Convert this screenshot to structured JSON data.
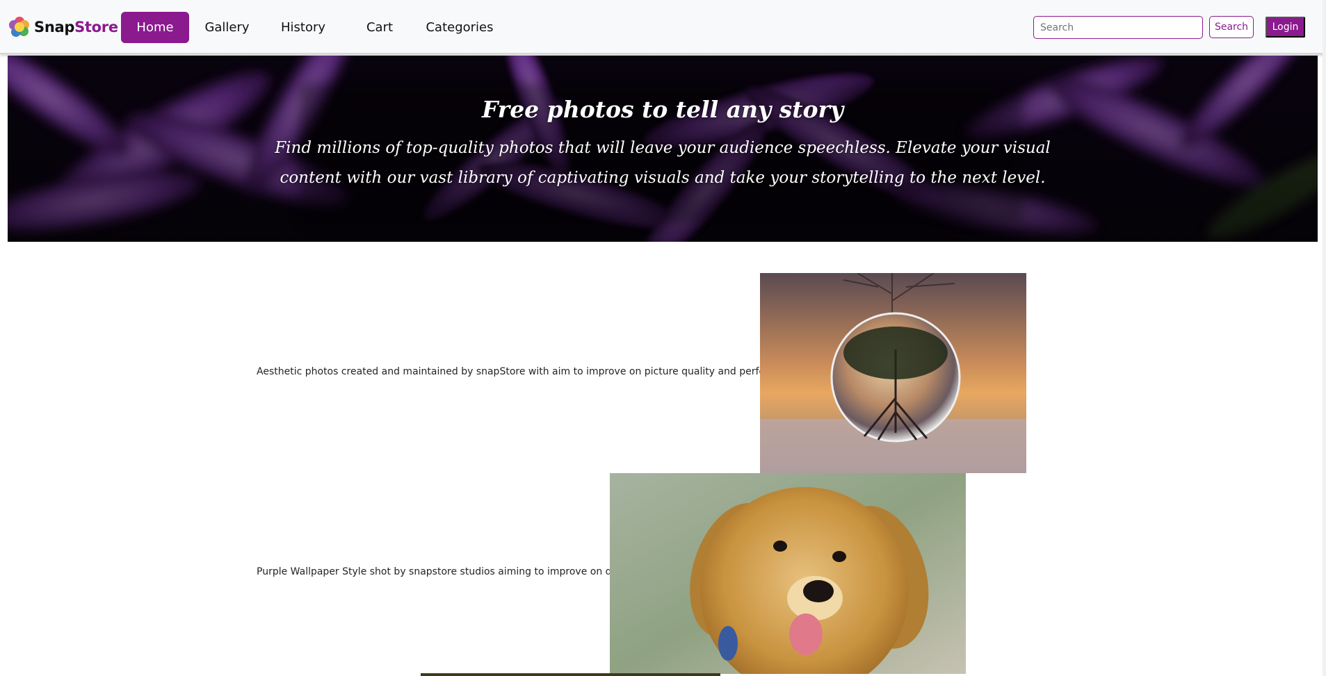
{
  "brand": {
    "name_part1": "Snap",
    "name_part2": "Store",
    "logo_icon": "flower-logo-icon",
    "colors": {
      "primary": "#8b1a8f"
    }
  },
  "nav": {
    "items": [
      {
        "label": "Home",
        "active": true
      },
      {
        "label": "Gallery",
        "active": false
      },
      {
        "label": "History",
        "active": false
      },
      {
        "label": "Cart",
        "active": false
      },
      {
        "label": "Categories",
        "active": false
      }
    ]
  },
  "search": {
    "placeholder": "Search",
    "value": "",
    "button_label": "Search"
  },
  "auth": {
    "login_label": "Login"
  },
  "hero": {
    "title": "Free photos to tell any story",
    "subtitle": "Find millions of top-quality photos that will leave your audience speechless. Elevate your visual content with our vast library of captivating visuals and take your storytelling to the next level."
  },
  "features": [
    {
      "text": "Aesthetic photos created and maintained by snapStore with aim to improve on picture quality and performance",
      "image": "crystal-ball-tree-photo"
    },
    {
      "text": "Purple Wallpaper Style shot by snapstore studios aiming to improve on quality",
      "image": "golden-puppy-photo"
    }
  ]
}
